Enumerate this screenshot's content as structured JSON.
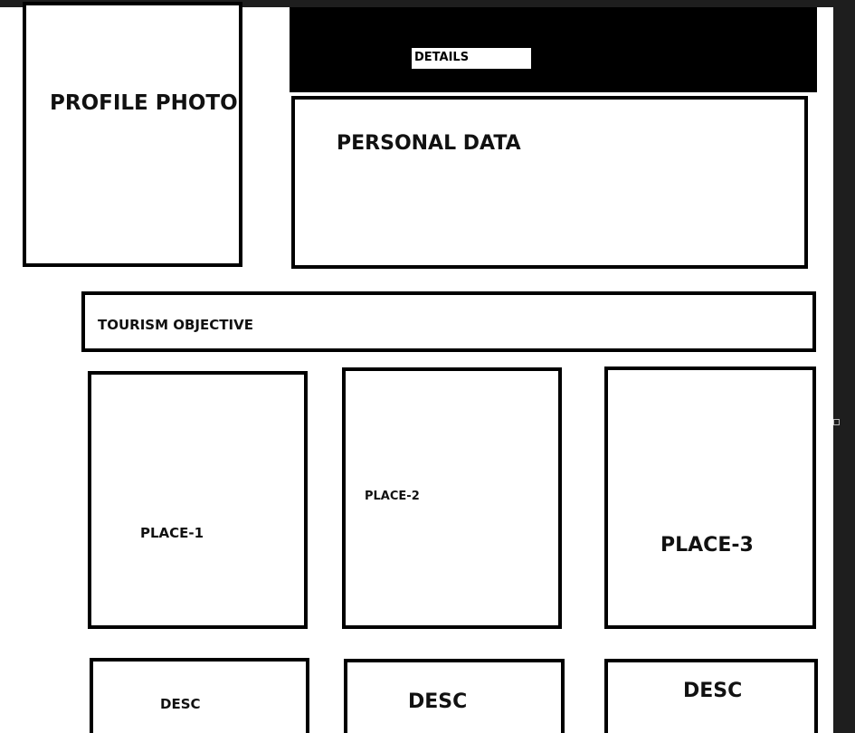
{
  "details": {
    "label": "DETAILS"
  },
  "profile": {
    "label": "PROFILE PHOTO"
  },
  "personal": {
    "label": "PERSONAL DATA"
  },
  "objective": {
    "label": "TOURISM OBJECTIVE"
  },
  "places": [
    {
      "label": "PLACE-1"
    },
    {
      "label": "PLACE-2"
    },
    {
      "label": "PLACE-3"
    }
  ],
  "descs": [
    {
      "label": "DESC"
    },
    {
      "label": "DESC"
    },
    {
      "label": "DESC"
    }
  ]
}
